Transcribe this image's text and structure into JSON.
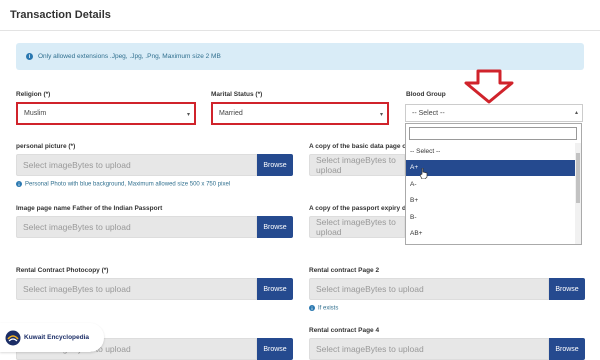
{
  "section": {
    "title": "Transaction Details"
  },
  "banner": {
    "text": "Only allowed extensions .Jpeg, .Jpg, .Png, Maximum size 2 MB"
  },
  "religion": {
    "label": "Religion (*)",
    "value": "Muslim"
  },
  "marital": {
    "label": "Marital Status (*)",
    "value": "Married"
  },
  "blood": {
    "label": "Blood Group",
    "value": "-- Select --",
    "options": [
      "-- Select --",
      "A+",
      "A-",
      "B+",
      "B-",
      "AB+"
    ],
    "selected_index": 1
  },
  "upload": {
    "placeholder": "Select imageBytes to upload",
    "browse_label": "Browse"
  },
  "fields": {
    "personal_picture": "personal picture (*)",
    "personal_hint": "Personal Photo with blue background, Maximum allowed size 500 x 750 pixel",
    "basic_data": "A copy of the basic data page of t",
    "father_passport": "Image page name Father of the Indian Passport",
    "passport_expiry": "A copy of the passport expiry date",
    "rental_photocopy": "Rental Contract Photocopy (*)",
    "rental_page2": "Rental contract Page 2",
    "if_exists": "If exists",
    "rental_page4": "Rental contract Page 4"
  },
  "logo": {
    "text": "Kuwait Encyclopedia"
  },
  "colors": {
    "primary": "#254a8f",
    "annotation_red": "#d0232b",
    "info": "#31708f"
  }
}
